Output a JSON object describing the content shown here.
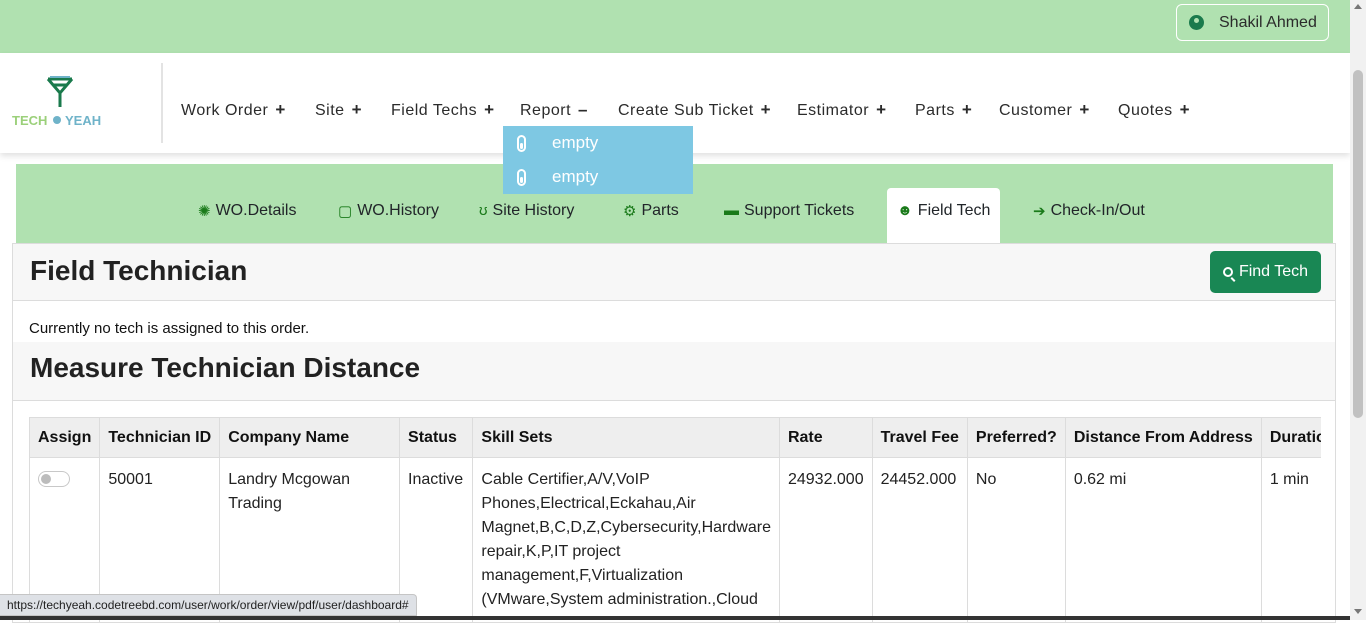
{
  "user": {
    "name": "Shakil Ahmed",
    "icon": "user-circle-icon"
  },
  "brand": {
    "logo_text": "TECH YEAH",
    "color": "#1a7a4c",
    "accent": "#6fb3c9"
  },
  "nav": [
    {
      "label": "Work Order",
      "sign": "+"
    },
    {
      "label": "Site",
      "sign": "+"
    },
    {
      "label": "Field Techs",
      "sign": "+"
    },
    {
      "label": "Report",
      "sign": "–"
    },
    {
      "label": "Create Sub Ticket",
      "sign": "+"
    },
    {
      "label": "Estimator",
      "sign": "+"
    },
    {
      "label": "Parts",
      "sign": "+"
    },
    {
      "label": "Customer",
      "sign": "+"
    },
    {
      "label": "Quotes",
      "sign": "+"
    }
  ],
  "report_dropdown": [
    {
      "label": "empty",
      "icon": "thermometer-icon"
    },
    {
      "label": "empty",
      "icon": "thermometer-icon"
    }
  ],
  "tabs": [
    {
      "label": "WO.Details",
      "icon": "cog-icon"
    },
    {
      "label": "WO.History",
      "icon": "note-icon"
    },
    {
      "label": "Site History",
      "icon": "stethoscope-icon"
    },
    {
      "label": "Parts",
      "icon": "cogs-icon"
    },
    {
      "label": "Support Tickets",
      "icon": "ticket-icon"
    },
    {
      "label": "Field Tech",
      "icon": "user-cog-icon",
      "active": true
    },
    {
      "label": "Check-In/Out",
      "icon": "sign-in-icon"
    }
  ],
  "field_tech": {
    "title": "Field Technician",
    "find_button": "Find Tech",
    "no_tech_message": "Currently no tech is assigned to this order."
  },
  "measure": {
    "title": "Measure Technician Distance",
    "columns": [
      "Assign",
      "Technician ID",
      "Company Name",
      "Status",
      "Skill Sets",
      "Rate",
      "Travel Fee",
      "Preferred?",
      "Distance From Address",
      "Duration"
    ],
    "rows": [
      {
        "technician_id": "50001",
        "company_name": "Landry Mcgowan Trading",
        "status": "Inactive",
        "skill_lines": [
          "Cable Certifier,A/V,VoIP",
          "Phones,Electrical,Eckahau,Air",
          "Magnet,B,C,D,Z,Cybersecurity,Hardware",
          "repair,K,P,IT project",
          "management,F,Virtualization",
          "(VMware,System administration.,Cloud"
        ],
        "rate": "24932.000",
        "travel_fee": "24452.000",
        "preferred": "No",
        "distance": "0.62 mi",
        "duration": "1 min"
      }
    ]
  },
  "status_url": "https://techyeah.codetreebd.com/user/work/order/view/pdf/user/dashboard#"
}
